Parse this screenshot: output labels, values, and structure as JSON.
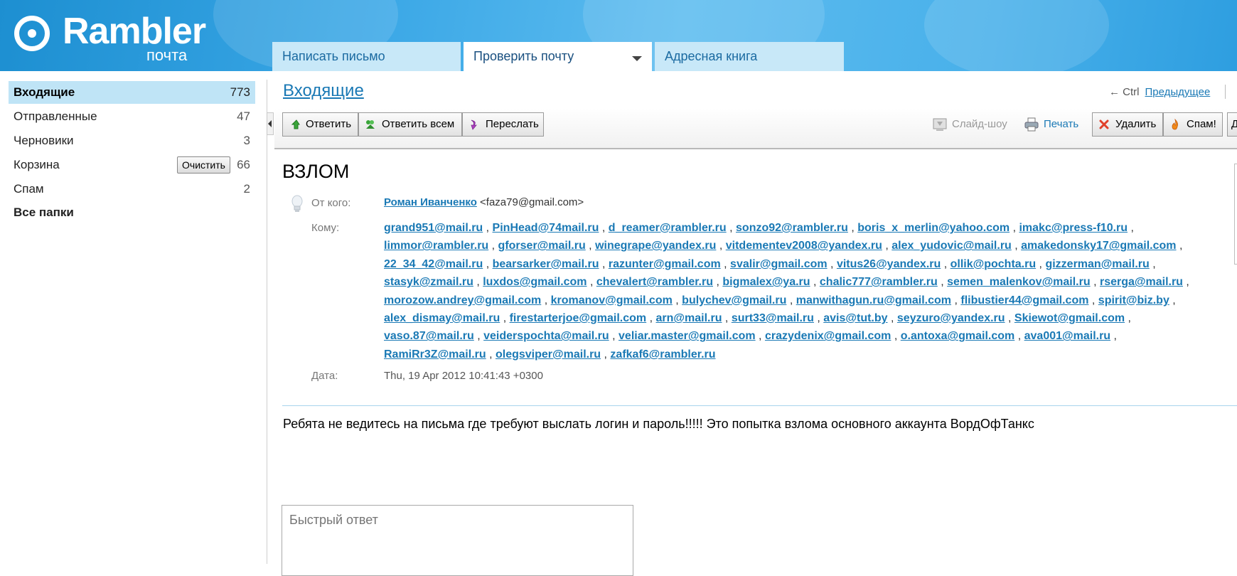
{
  "brand": {
    "name": "Rambler",
    "sub": "почта"
  },
  "tabs": [
    {
      "label": "Написать письмо"
    },
    {
      "label": "Проверить почту"
    },
    {
      "label": "Адресная книга"
    }
  ],
  "folders": [
    {
      "label": "Входящие",
      "count": "773"
    },
    {
      "label": "Отправленные",
      "count": "47"
    },
    {
      "label": "Черновики",
      "count": "3"
    },
    {
      "label": "Корзина",
      "count": "66"
    },
    {
      "label": "Спам",
      "count": "2"
    },
    {
      "label": "Все папки",
      "count": ""
    }
  ],
  "clear_button": "Очистить",
  "current_folder": "Входящие",
  "nav": {
    "shortcut": "← Ctrl",
    "prev_label": "Предыдущее"
  },
  "toolbar": {
    "reply": "Ответить",
    "reply_all": "Ответить всем",
    "forward": "Переслать",
    "slideshow": "Слайд-шоу",
    "print": "Печать",
    "delete": "Удалить",
    "spam": "Спам!",
    "more": "Д"
  },
  "message": {
    "subject": "ВЗЛОМ",
    "from_label": "От кого:",
    "from_name": "Роман Иванченко",
    "from_email": "<faza79@gmail.com>",
    "to_label": "Кому:",
    "recipients": [
      "grand951@mail.ru",
      "PinHead@74mail.ru",
      "d_reamer@rambler.ru",
      "sonzo92@rambler.ru",
      "boris_x_merlin@yahoo.com",
      "imakc@press-f10.ru",
      "limmor@rambler.ru",
      "gforser@mail.ru",
      "winegrape@yandex.ru",
      "vitdementev2008@yandex.ru",
      "alex_yudovic@mail.ru",
      "amakedonsky17@gmail.com",
      "22_34_42@mail.ru",
      "bearsarker@mail.ru",
      "razunter@gmail.com",
      "svalir@gmail.com",
      "vitus26@yandex.ru",
      "ollik@pochta.ru",
      "gizzerman@mail.ru",
      "stasyk@zmail.ru",
      "luxdos@gmail.com",
      "chevalert@rambler.ru",
      "bigmalex@ya.ru",
      "chalic777@rambler.ru",
      "semen_malenkov@mail.ru",
      "rserga@mail.ru",
      "morozow.andrey@gmail.com",
      "kromanov@gmail.com",
      "bulychev@gmail.ru",
      "manwithagun.ru@gmail.com",
      "flibustier44@gmail.com",
      "spirit@biz.by",
      "alex_dismay@mail.ru",
      "firestarterjoe@gmail.com",
      "arn@mail.ru",
      "surt33@mail.ru",
      "avis@tut.by",
      "seyzuro@yandex.ru",
      "Skiewot@gmail.com",
      "vaso.87@mail.ru",
      "veiderspochta@mail.ru",
      "veliar.master@gmail.com",
      "crazydenix@gmail.com",
      "o.antoxa@gmail.com",
      "ava001@mail.ru",
      "RamiRr3Z@mail.ru",
      "olegsviper@mail.ru",
      "zafkaf6@rambler.ru"
    ],
    "date_label": "Дата:",
    "date": "Thu, 19 Apr 2012 10:41:43 +0300",
    "body": "Ребята не ведитесь на письма где требуют выслать логин и пароль!!!!! Это попытка взлома основного аккаунта ВордОфТанкс"
  },
  "quick_reply": {
    "placeholder": "Быстрый ответ"
  },
  "colors": {
    "link": "#1a79b5",
    "header": "#3aa7e6",
    "selected": "#bfe4f6"
  }
}
